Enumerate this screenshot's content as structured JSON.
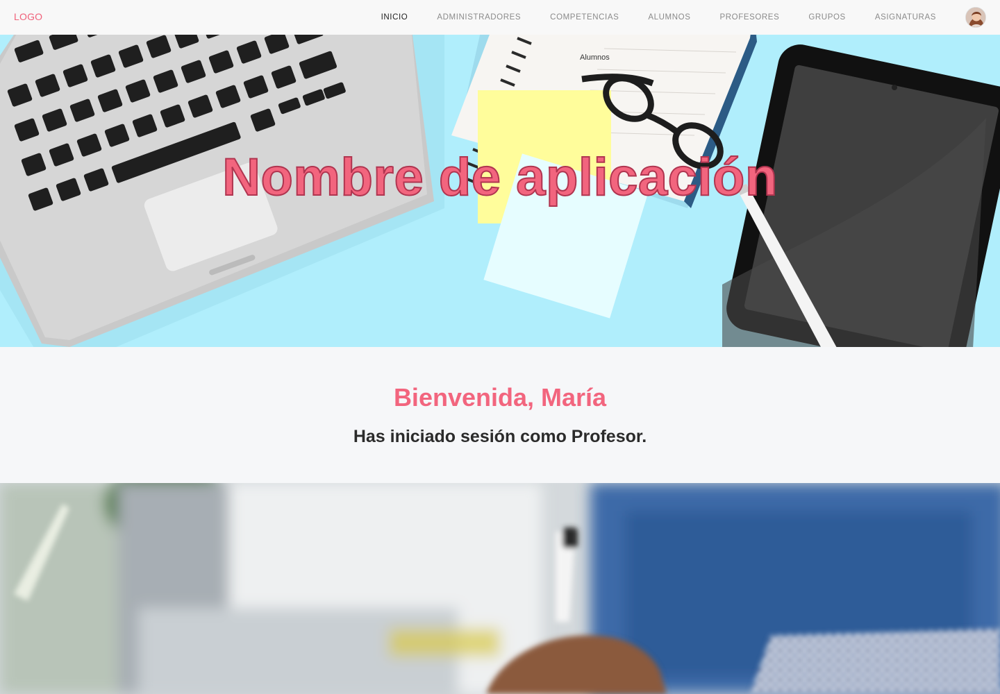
{
  "nav": {
    "logo": "LOGO",
    "items": [
      {
        "label": "INICIO",
        "active": true
      },
      {
        "label": "ADMINISTRADORES",
        "active": false
      },
      {
        "label": "COMPETENCIAS",
        "active": false
      },
      {
        "label": "ALUMNOS",
        "active": false
      },
      {
        "label": "PROFESORES",
        "active": false
      },
      {
        "label": "GRUPOS",
        "active": false
      },
      {
        "label": "ASIGNATURAS",
        "active": false
      }
    ],
    "avatar_icon": "user-avatar-icon"
  },
  "hero": {
    "title": "Nombre de aplicación",
    "tooltip": "Alumnos"
  },
  "welcome": {
    "title": "Bienvenida, María",
    "subtitle": "Has iniciado sesión como Profesor."
  },
  "colors": {
    "accent": "#f2657e",
    "hero_bg": "#b0eefc",
    "nav_bg": "#f8f8f8",
    "page_bg": "#f6f7f9"
  }
}
